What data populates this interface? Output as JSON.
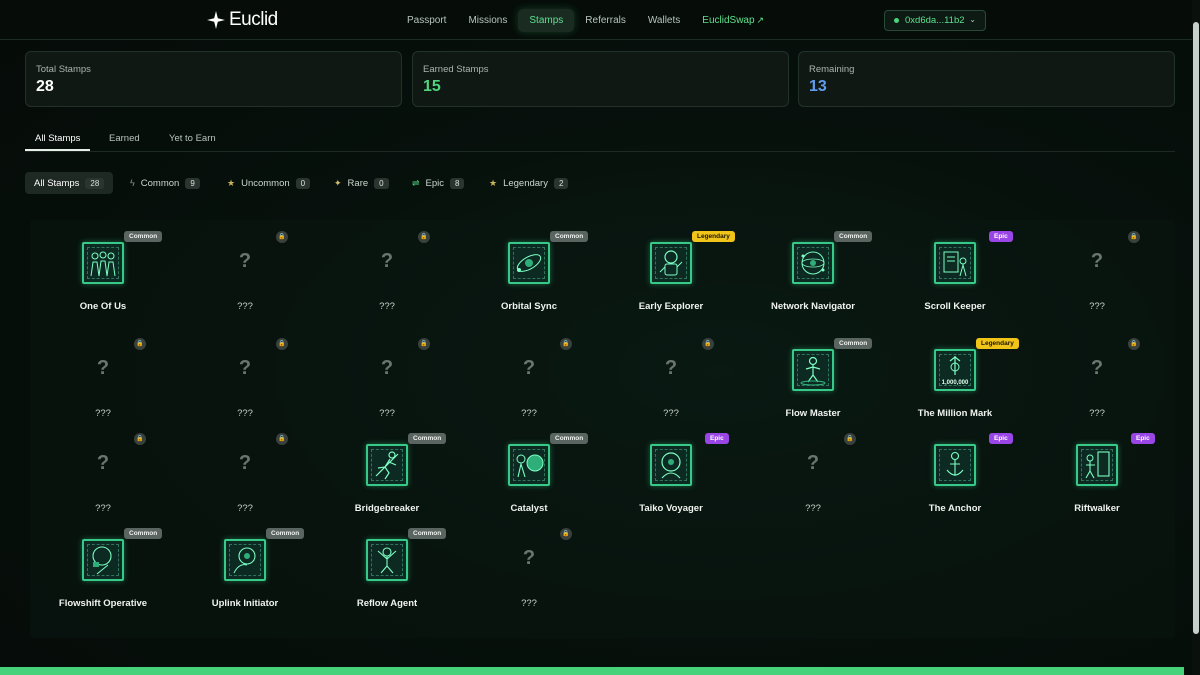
{
  "brand": {
    "name": "Euclid"
  },
  "nav": {
    "items": [
      "Passport",
      "Missions",
      "Stamps",
      "Referrals",
      "Wallets"
    ],
    "swap_label": "EuclidSwap",
    "active": "Stamps"
  },
  "wallet": {
    "address": "0xd6da...11b2"
  },
  "stats": [
    {
      "label": "Total Stamps",
      "value": "28",
      "color": "#ffffff"
    },
    {
      "label": "Earned Stamps",
      "value": "15",
      "color": "#4fd47f"
    },
    {
      "label": "Remaining",
      "value": "13",
      "color": "#5f9cf0"
    }
  ],
  "tabs": [
    "All Stamps",
    "Earned",
    "Yet to Earn"
  ],
  "filters": [
    {
      "label": "All Stamps",
      "count": "28",
      "icon": ""
    },
    {
      "label": "Common",
      "count": "9",
      "icon": "lightning-icon"
    },
    {
      "label": "Uncommon",
      "count": "0",
      "icon": "star-icon"
    },
    {
      "label": "Rare",
      "count": "0",
      "icon": "sparkle-icon"
    },
    {
      "label": "Epic",
      "count": "8",
      "icon": "flow-icon"
    },
    {
      "label": "Legendary",
      "count": "2",
      "icon": "star-icon"
    }
  ],
  "stamps": [
    {
      "name": "One Of Us",
      "rarity": "Common",
      "earned": true,
      "icon": "crowd-icon"
    },
    {
      "name": "???",
      "earned": false
    },
    {
      "name": "???",
      "earned": false
    },
    {
      "name": "Orbital Sync",
      "rarity": "Common",
      "earned": true,
      "icon": "orbit-icon"
    },
    {
      "name": "Early Explorer",
      "rarity": "Legendary",
      "earned": true,
      "icon": "astronaut-icon"
    },
    {
      "name": "Network Navigator",
      "rarity": "Common",
      "earned": true,
      "icon": "network-icon"
    },
    {
      "name": "Scroll Keeper",
      "rarity": "Epic",
      "earned": true,
      "icon": "scroll-icon"
    },
    {
      "name": "???",
      "earned": false
    },
    {
      "name": "???",
      "earned": false
    },
    {
      "name": "???",
      "earned": false
    },
    {
      "name": "???",
      "earned": false
    },
    {
      "name": "???",
      "earned": false
    },
    {
      "name": "???",
      "earned": false
    },
    {
      "name": "Flow Master",
      "rarity": "Common",
      "earned": true,
      "icon": "flow-icon"
    },
    {
      "name": "The Million Mark",
      "rarity": "Legendary",
      "earned": true,
      "icon": "million-icon",
      "label": "1,000,000"
    },
    {
      "name": "???",
      "earned": false
    },
    {
      "name": "???",
      "earned": false
    },
    {
      "name": "???",
      "earned": false
    },
    {
      "name": "Bridgebreaker",
      "rarity": "Common",
      "earned": true,
      "icon": "runner-icon"
    },
    {
      "name": "Catalyst",
      "rarity": "Common",
      "earned": true,
      "icon": "catalyst-icon"
    },
    {
      "name": "Taiko Voyager",
      "rarity": "Epic",
      "earned": true,
      "icon": "voyager-icon"
    },
    {
      "name": "???",
      "earned": false
    },
    {
      "name": "The Anchor",
      "rarity": "Epic",
      "earned": true,
      "icon": "anchor-icon"
    },
    {
      "name": "Riftwalker",
      "rarity": "Epic",
      "earned": true,
      "icon": "portal-icon"
    },
    {
      "name": "Flowshift Operative",
      "rarity": "Common",
      "earned": true,
      "icon": "operative-icon"
    },
    {
      "name": "Uplink Initiator",
      "rarity": "Common",
      "earned": true,
      "icon": "uplink-icon"
    },
    {
      "name": "Reflow Agent",
      "rarity": "Common",
      "earned": true,
      "icon": "agent-icon"
    },
    {
      "name": "???",
      "earned": false
    }
  ]
}
